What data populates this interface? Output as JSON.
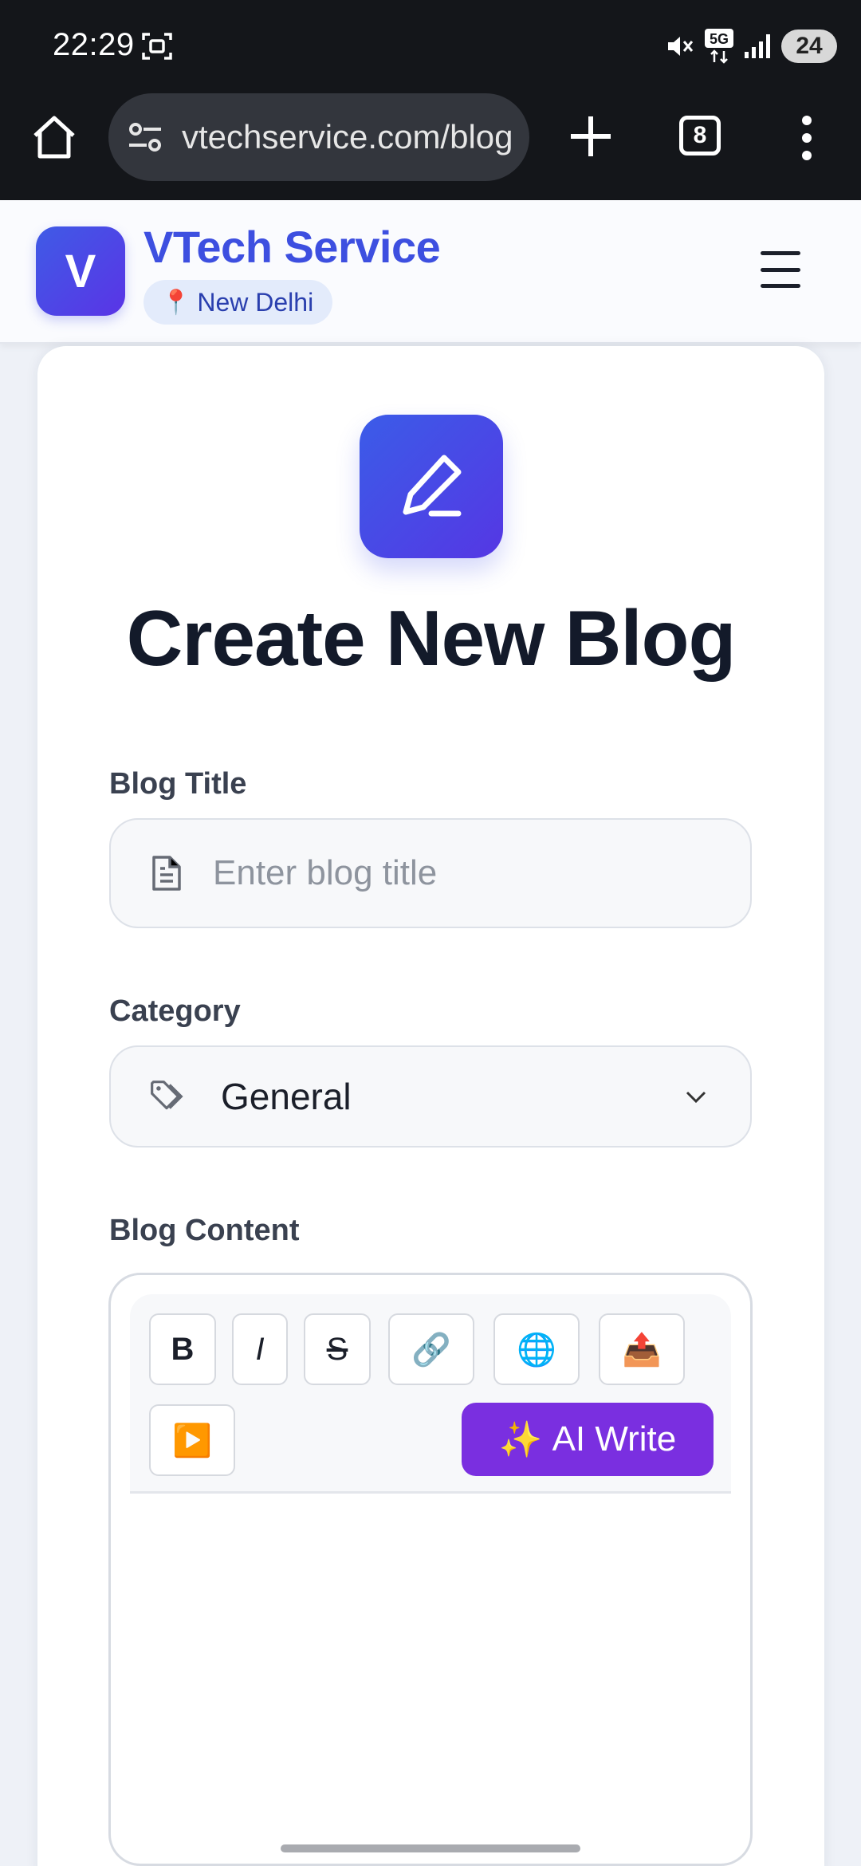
{
  "status_bar": {
    "time": "22:29",
    "battery": "24",
    "icons": [
      "screenshot-icon",
      "mute-icon",
      "5g-icon",
      "signal-icon",
      "battery-icon"
    ]
  },
  "browser": {
    "url": "vtechservice.com/blog",
    "tab_count": "8",
    "icons": [
      "home-icon",
      "site-settings-icon",
      "plus-icon",
      "tabs-icon",
      "more-vert-icon"
    ]
  },
  "site": {
    "logo_letter": "V",
    "brand": "VTech Service",
    "location": "New Delhi",
    "location_icon": "pin-icon",
    "menu_icon": "hamburger-icon"
  },
  "form": {
    "header_icon": "pencil-icon",
    "title": "Create New Blog",
    "title_label": "Blog Title",
    "title_placeholder": "Enter blog title",
    "title_value": "",
    "category_label": "Category",
    "category_value": "General",
    "content_label": "Blog Content",
    "toolbar": {
      "bold": "B",
      "italic": "I",
      "strike": "S",
      "link": "🔗",
      "globe": "🌐",
      "upload": "📤",
      "video": "▶️",
      "ai_icon": "✨",
      "ai_label": "AI Write"
    }
  },
  "colors": {
    "brand": "#3d4fe0",
    "ai_button": "#7a2fe0",
    "dark_bar": "#14161a",
    "title_text": "#131a2a"
  }
}
